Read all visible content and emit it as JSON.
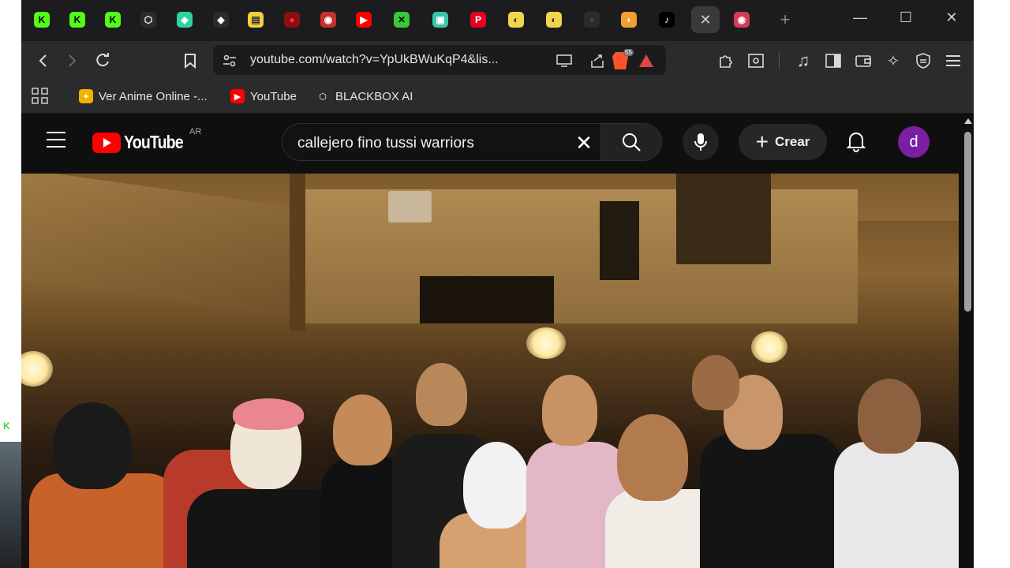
{
  "browser": {
    "tabs": [
      {
        "name": "kick-k-green",
        "glyph": "K",
        "color": "#53fc18",
        "text_color": "#000"
      },
      {
        "name": "kick-k-green",
        "glyph": "K",
        "color": "#53fc18",
        "text_color": "#000"
      },
      {
        "name": "kick-k-green",
        "glyph": "K",
        "color": "#53fc18",
        "text_color": "#000"
      },
      {
        "name": "blackbox-hex",
        "glyph": "⬡",
        "color": "#2b2b2b",
        "text_color": "#fff"
      },
      {
        "name": "bot-green",
        "glyph": "◈",
        "color": "#2fd3a0",
        "text_color": "#fff"
      },
      {
        "name": "diamond-white",
        "glyph": "◆",
        "color": "#2b2b2b",
        "text_color": "#fff"
      },
      {
        "name": "docs-doc",
        "glyph": "▤",
        "color": "#f4d03f",
        "text_color": "#2b2b2b"
      },
      {
        "name": "red-circle",
        "glyph": "●",
        "color": "#8a0f0f",
        "text_color": "#ff3030"
      },
      {
        "name": "record-red",
        "glyph": "◉",
        "color": "#c9302c",
        "text_color": "#fff"
      },
      {
        "name": "youtube-play",
        "glyph": "▶",
        "color": "#ff0000",
        "text_color": "#fff"
      },
      {
        "name": "x-green",
        "glyph": "✕",
        "color": "#38c838",
        "text_color": "#000"
      },
      {
        "name": "teal-square",
        "glyph": "▣",
        "color": "#36c5a8",
        "text_color": "#fff"
      },
      {
        "name": "pinterest-p",
        "glyph": "P",
        "color": "#e60023",
        "text_color": "#fff"
      },
      {
        "name": "emoji-pill",
        "glyph": "◐",
        "color": "#f2d54c",
        "text_color": "#333"
      },
      {
        "name": "emoji-pill",
        "glyph": "◐",
        "color": "#f2d54c",
        "text_color": "#333"
      },
      {
        "name": "dark-dot",
        "glyph": "●",
        "color": "#2b2b2b",
        "text_color": "#444"
      },
      {
        "name": "bread-orange",
        "glyph": "◗",
        "color": "#f0a030",
        "text_color": "#fff"
      },
      {
        "name": "tiktok-note",
        "glyph": "♪",
        "color": "#000",
        "text_color": "#fff"
      },
      {
        "name": "active-close",
        "glyph": "✕",
        "color": "transparent",
        "text_color": "#cfcfcf"
      },
      {
        "name": "record-pink",
        "glyph": "◉",
        "color": "#d63a5a",
        "text_color": "#fff"
      }
    ],
    "new_tab_glyph": "+",
    "minimize_glyph": "—",
    "maximize_glyph": "☐",
    "close_glyph": "✕",
    "url": "youtube.com/watch?v=YpUkBWuKqP4&lis...",
    "brave_shield_count": "55",
    "bookmarks": [
      {
        "label": "Ver Anime Online -...",
        "fav_glyph": "✦",
        "fav_color": "#f0b400"
      },
      {
        "label": "YouTube",
        "fav_glyph": "▶",
        "fav_color": "#ff0000"
      },
      {
        "label": "BLACKBOX AI",
        "fav_glyph": "⬡",
        "fav_color": "#2b2b2b"
      }
    ]
  },
  "youtube": {
    "logo_text": "YouTube",
    "region": "AR",
    "search_query": "callejero fino tussi warriors",
    "create_label": "Crear",
    "avatar_letter": "d",
    "avatar_color": "#7b1fa2"
  },
  "colors": {
    "yt_red": "#ff0000",
    "tab_bg": "#1c1c1e",
    "toolbar_bg": "#2b2b2e"
  }
}
